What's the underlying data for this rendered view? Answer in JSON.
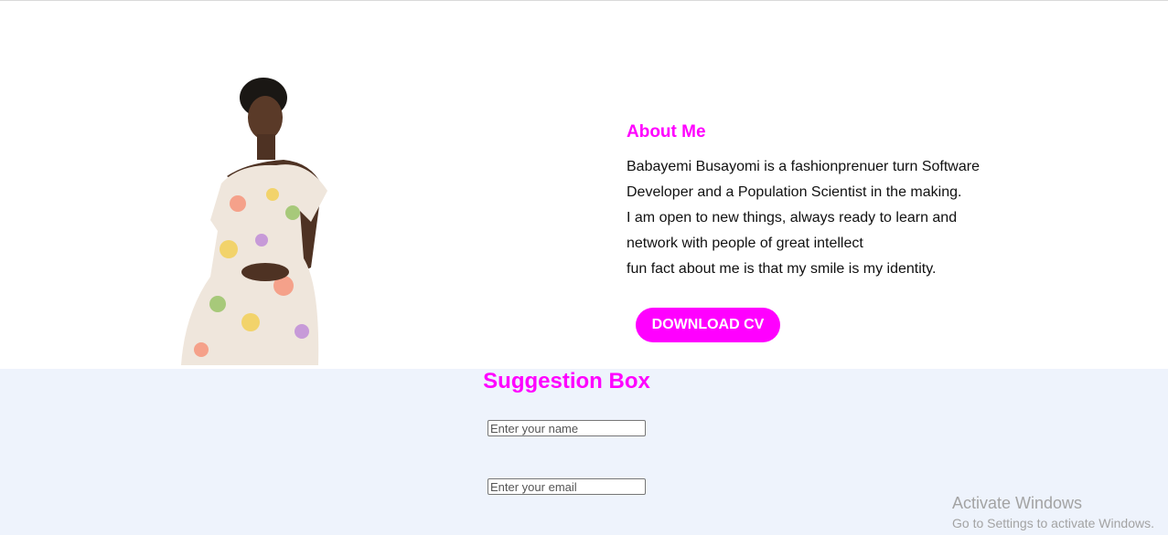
{
  "about": {
    "heading": "About Me",
    "bio_lines": [
      "Babayemi Busayomi is a fashionprenuer turn Software",
      "Developer and a Population Scientist in the making.",
      "I am open to new things, always ready to learn and",
      "network with people of great intellect",
      "fun fact about me is that my smile is my identity."
    ],
    "download_label": "DOWNLOAD CV"
  },
  "suggestion": {
    "heading": "Suggestion Box",
    "name_placeholder": "Enter your name",
    "email_placeholder": "Enter your email"
  },
  "watermark": {
    "line1": "Activate Windows",
    "line2": "Go to Settings to activate Windows."
  },
  "colors": {
    "accent": "#ff00ff",
    "section_bg": "#eef3fc",
    "text": "#111111"
  }
}
